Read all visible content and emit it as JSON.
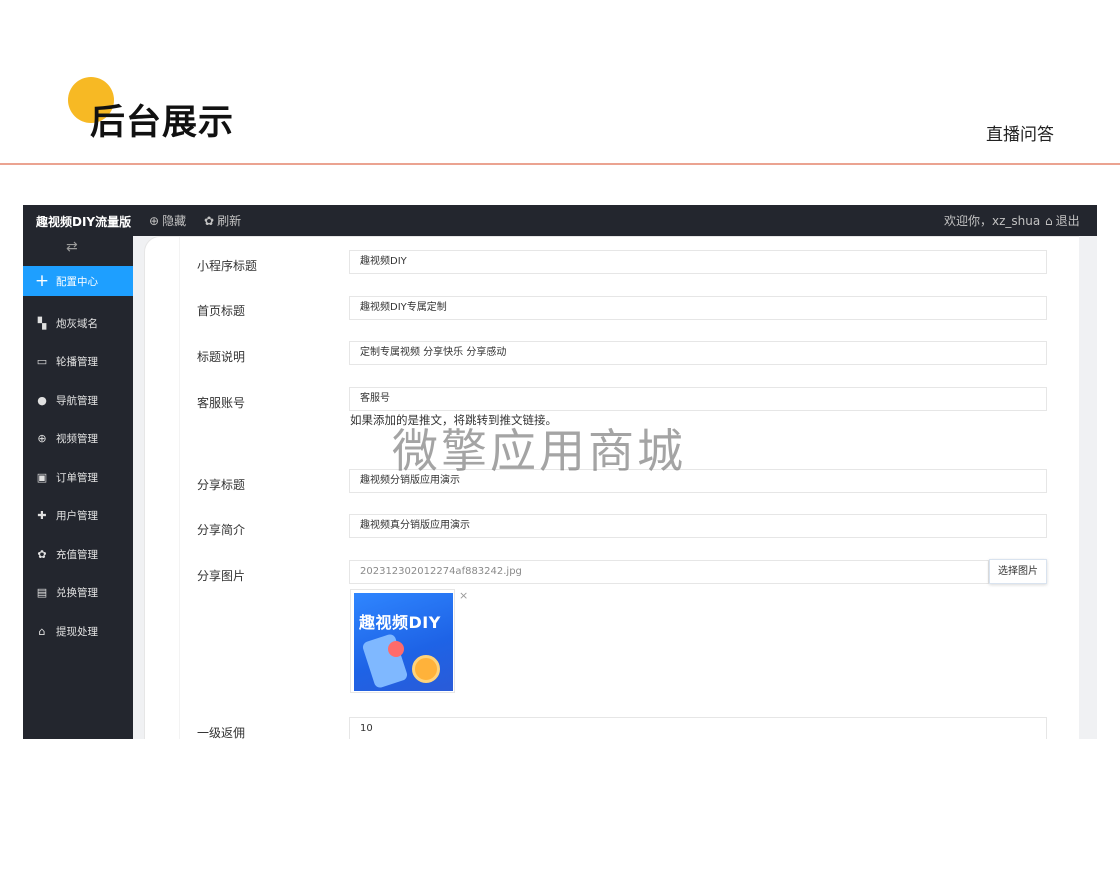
{
  "slide": {
    "title": "后台展示",
    "subtitle": "直播问答"
  },
  "topbar": {
    "brand": "趣视频DIY流量版",
    "hide_label": "隐藏",
    "refresh_label": "刷新",
    "welcome": "欢迎你，xz_shua",
    "logout_label": "退出"
  },
  "sidebar": {
    "items": [
      {
        "label": "配置中心",
        "icon": "plus-icon",
        "active": true
      },
      {
        "label": "炮灰域名",
        "icon": "grid-icon"
      },
      {
        "label": "轮播管理",
        "icon": "card-icon"
      },
      {
        "label": "导航管理",
        "icon": "user-icon"
      },
      {
        "label": "视频管理",
        "icon": "globe-icon"
      },
      {
        "label": "订单管理",
        "icon": "ticket-icon"
      },
      {
        "label": "用户管理",
        "icon": "puzzle-icon"
      },
      {
        "label": "充值管理",
        "icon": "gear-icon"
      },
      {
        "label": "兑换管理",
        "icon": "wallet-icon"
      },
      {
        "label": "提现处理",
        "icon": "home-icon"
      }
    ]
  },
  "form": {
    "mini_title": {
      "label": "小程序标题",
      "value": "趣视频DIY"
    },
    "home_title": {
      "label": "首页标题",
      "value": "趣视频DIY专属定制"
    },
    "title_desc": {
      "label": "标题说明",
      "value": "定制专属视频 分享快乐 分享感动"
    },
    "service": {
      "label": "客服账号",
      "value": "客服号",
      "hint": "如果添加的是推文，将跳转到推文链接。"
    },
    "share_title": {
      "label": "分享标题",
      "value": "趣视频分销版应用演示"
    },
    "share_intro": {
      "label": "分享简介",
      "value": "趣视频真分销版应用演示"
    },
    "share_image": {
      "label": "分享图片",
      "value": "202312302012274af883242.jpg",
      "button": "选择图片",
      "thumb_text": "趣视频DIY",
      "close": "×"
    },
    "commission1": {
      "label": "一级返佣",
      "value": "10"
    }
  },
  "watermark": "微擎应用商城"
}
